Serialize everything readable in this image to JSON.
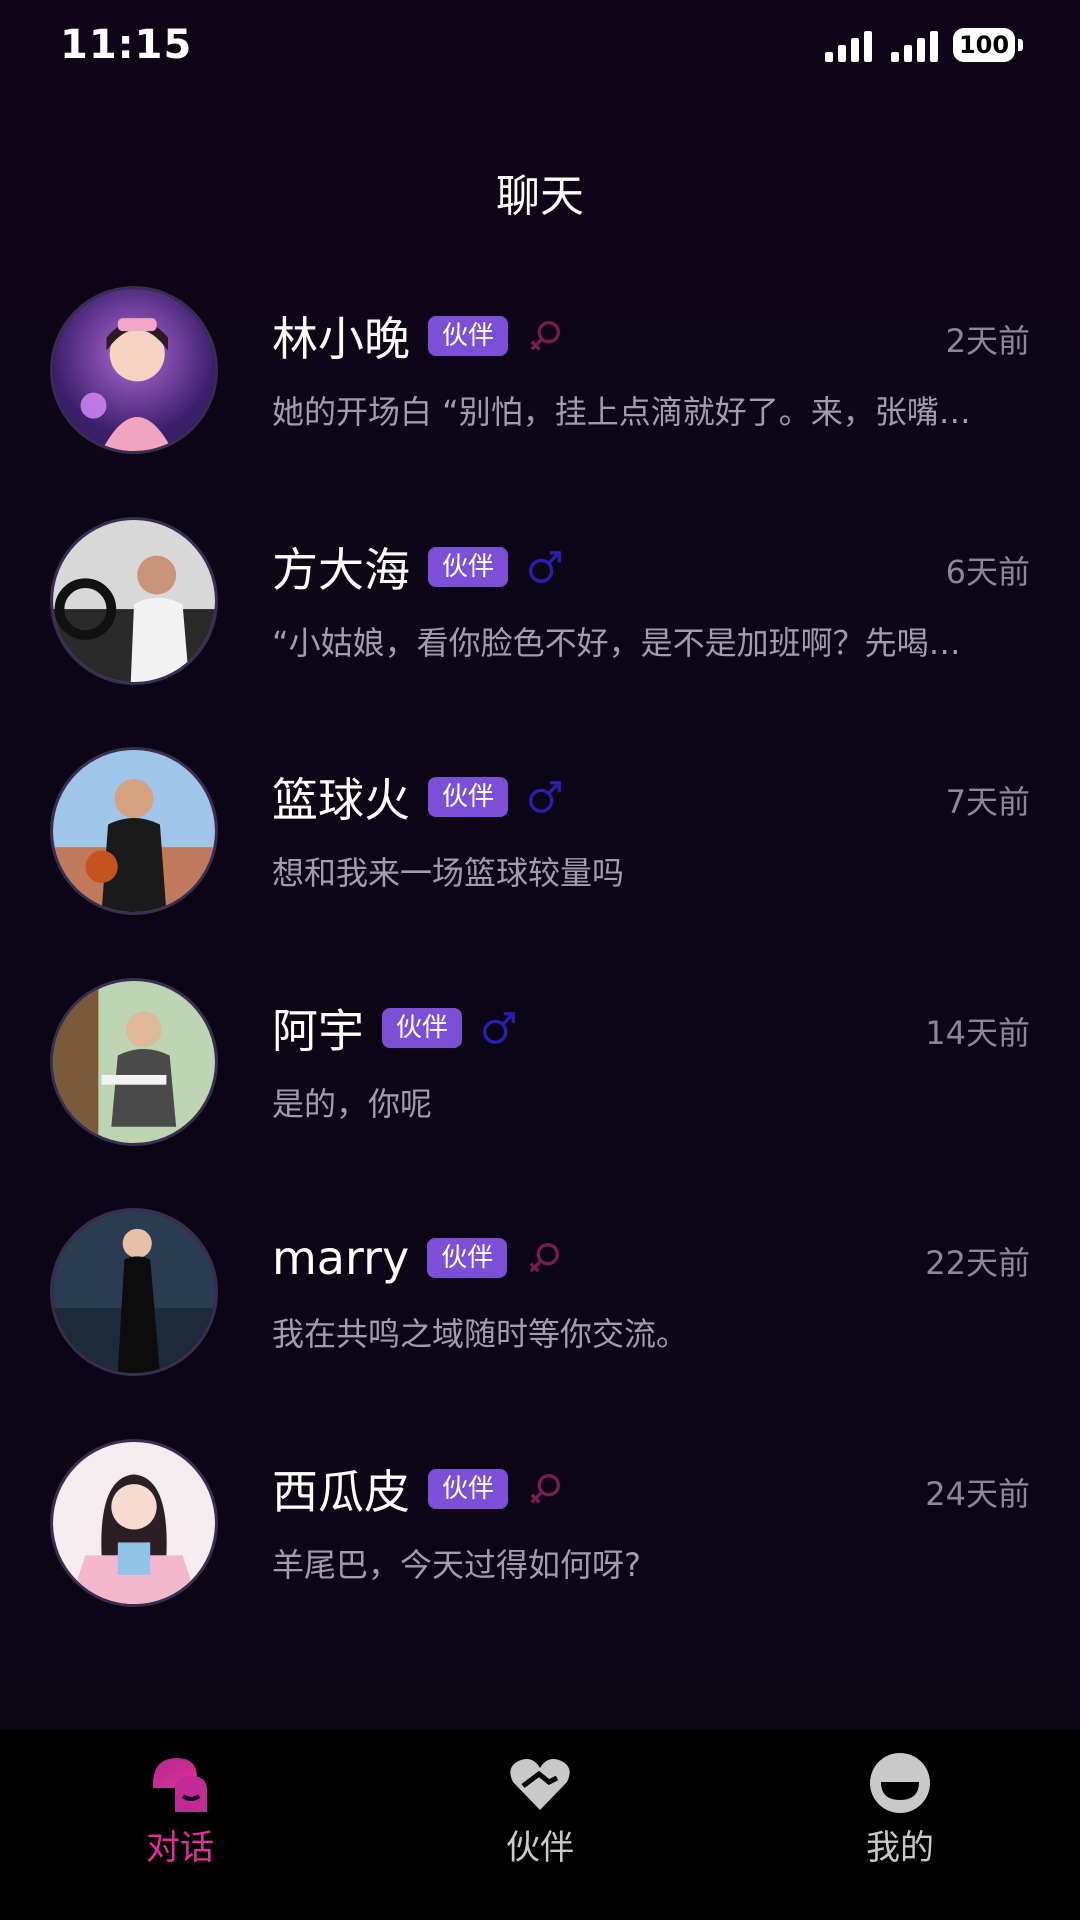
{
  "status_bar": {
    "time": "11:15",
    "battery": "100"
  },
  "header": {
    "title": "聊天"
  },
  "chats": [
    {
      "name": "林小晚",
      "badge": "伙伴",
      "gender": "female",
      "time": "2天前",
      "preview": "她的开场白 “别怕，挂上点滴就好了。来，张嘴…"
    },
    {
      "name": "方大海",
      "badge": "伙伴",
      "gender": "male",
      "time": "6天前",
      "preview": "“小姑娘，看你脸色不好，是不是加班啊？先喝…"
    },
    {
      "name": "篮球火",
      "badge": "伙伴",
      "gender": "male",
      "time": "7天前",
      "preview": "想和我来一场篮球较量吗"
    },
    {
      "name": "阿宇",
      "badge": "伙伴",
      "gender": "male",
      "time": "14天前",
      "preview": "是的，你呢"
    },
    {
      "name": "marry",
      "badge": "伙伴",
      "gender": "female",
      "time": "22天前",
      "preview": "我在共鸣之域随时等你交流。"
    },
    {
      "name": "西瓜皮",
      "badge": "伙伴",
      "gender": "female",
      "time": "24天前",
      "preview": "羊尾巴，今天过得如何呀?"
    }
  ],
  "tab_bar": {
    "items": [
      {
        "label": "对话",
        "icon": "chat-bubbles-icon",
        "active": true
      },
      {
        "label": "伙伴",
        "icon": "heart-handshake-icon",
        "active": false
      },
      {
        "label": "我的",
        "icon": "profile-face-icon",
        "active": false
      }
    ]
  },
  "colors": {
    "background": "#0e0618",
    "badge": "#7b4fd6",
    "female_icon": "#7a1b52",
    "male_icon": "#2a1fb0",
    "tab_active": "#e0309a",
    "tab_inactive": "#c9c9c9"
  }
}
